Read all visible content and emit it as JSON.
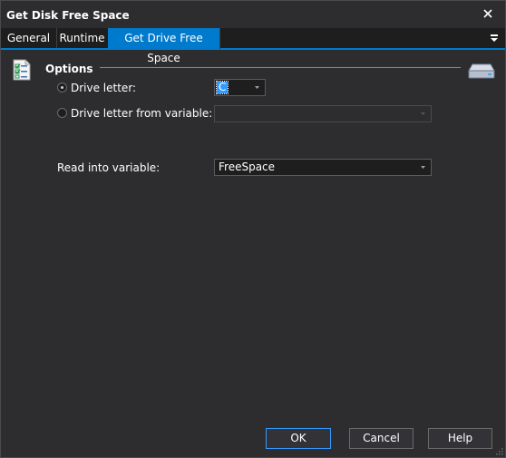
{
  "window": {
    "title": "Get Disk Free Space"
  },
  "tabs": [
    {
      "label": "General"
    },
    {
      "label": "Runtime"
    },
    {
      "label": "Get Drive Free Space"
    }
  ],
  "options": {
    "section_title": "Options",
    "drive_letter": {
      "label": "Drive letter:",
      "value": "C",
      "selected": true
    },
    "drive_letter_from_variable": {
      "label": "Drive letter from variable:",
      "value": "",
      "selected": false
    },
    "read_into_variable": {
      "label": "Read into variable:",
      "value": "FreeSpace"
    }
  },
  "buttons": {
    "ok": "OK",
    "cancel": "Cancel",
    "help": "Help"
  },
  "colors": {
    "accent": "#007acc",
    "background": "#2d2d30",
    "field": "#1e1e1e",
    "selection": "#3399ff"
  },
  "icons": [
    "close-icon",
    "tab-menu-icon",
    "checklist-icon",
    "hard-drive-icon",
    "chevron-down-icon",
    "resize-grip-icon"
  ]
}
